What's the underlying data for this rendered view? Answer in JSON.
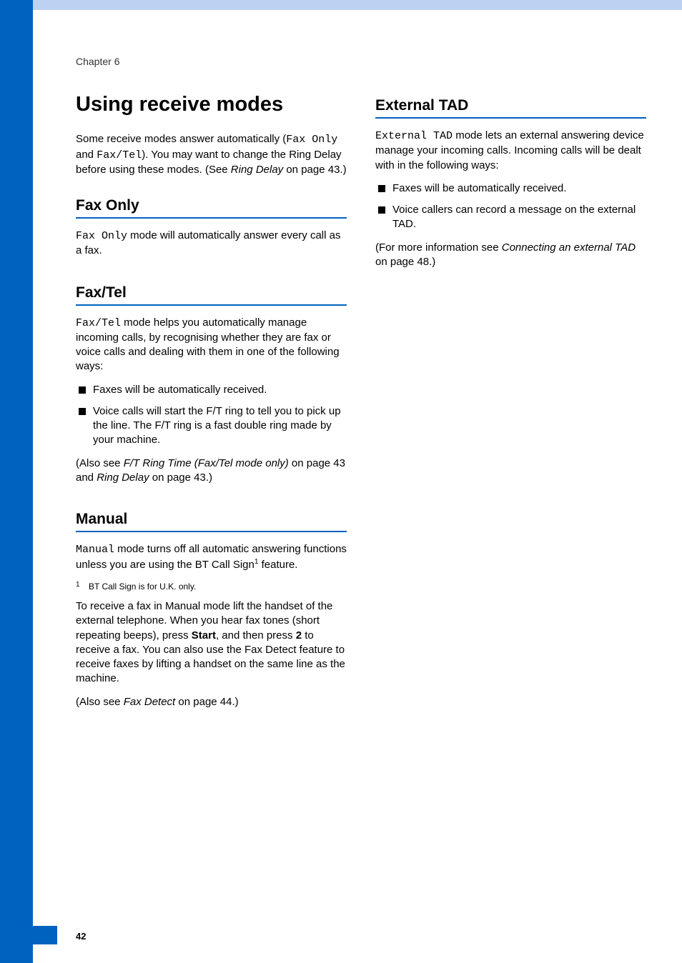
{
  "chapter": "Chapter 6",
  "title": "Using receive modes",
  "intro_pre": "Some receive modes answer automatically (",
  "intro_mono1": "Fax Only",
  "intro_mid1": " and ",
  "intro_mono2": "Fax/Tel",
  "intro_mid2": "). You may want to change the Ring Delay before using these modes. (See ",
  "intro_ital": "Ring Delay",
  "intro_post": " on page 43.)",
  "faxonly": {
    "heading": "Fax Only",
    "mono": "Fax Only",
    "rest": " mode will automatically answer every call as a fax."
  },
  "faxtel": {
    "heading": "Fax/Tel",
    "mono": "Fax/Tel",
    "rest": " mode helps you automatically manage incoming calls, by recognising whether they are fax or voice calls and dealing with them in one of the following ways:",
    "bul1": "Faxes will be automatically received.",
    "bul2": "Voice calls will start the F/T ring to tell you to pick up the line. The F/T ring is a fast double ring made by your machine.",
    "also_pre": "(Also see ",
    "also_ital1": "F/T Ring Time (Fax/Tel mode only)",
    "also_mid1": " on page 43 and ",
    "also_ital2": "Ring Delay",
    "also_post": " on page 43.)"
  },
  "manual": {
    "heading": "Manual",
    "mono": "Manual",
    "rest1": " mode turns off all automatic answering functions unless you are using the BT Call Sign",
    "sup": "1",
    "rest2": " feature.",
    "footnote_sup": "1",
    "footnote": "BT Call Sign is for U.K. only.",
    "p2_pre": "To receive a fax in Manual mode lift the handset of the external telephone. When you hear fax tones (short repeating beeps), press ",
    "p2_b1": "Start",
    "p2_mid": ", and then press ",
    "p2_b2": "2",
    "p2_post": " to receive a fax. You can also use the Fax Detect feature to receive faxes by lifting a handset on the same line as the machine.",
    "also_pre": "(Also see ",
    "also_ital": "Fax Detect",
    "also_post": " on page 44.)"
  },
  "external": {
    "heading": "External TAD",
    "mono": "External TAD",
    "rest": " mode lets an external answering device manage your incoming calls. Incoming calls will be dealt with in the following ways:",
    "bul1": "Faxes will be automatically received.",
    "bul2": "Voice callers can record a message on the external TAD.",
    "more_pre": "(For more information see ",
    "more_ital": "Connecting an external TAD",
    "more_post": " on page 48.)"
  },
  "pagenum": "42"
}
